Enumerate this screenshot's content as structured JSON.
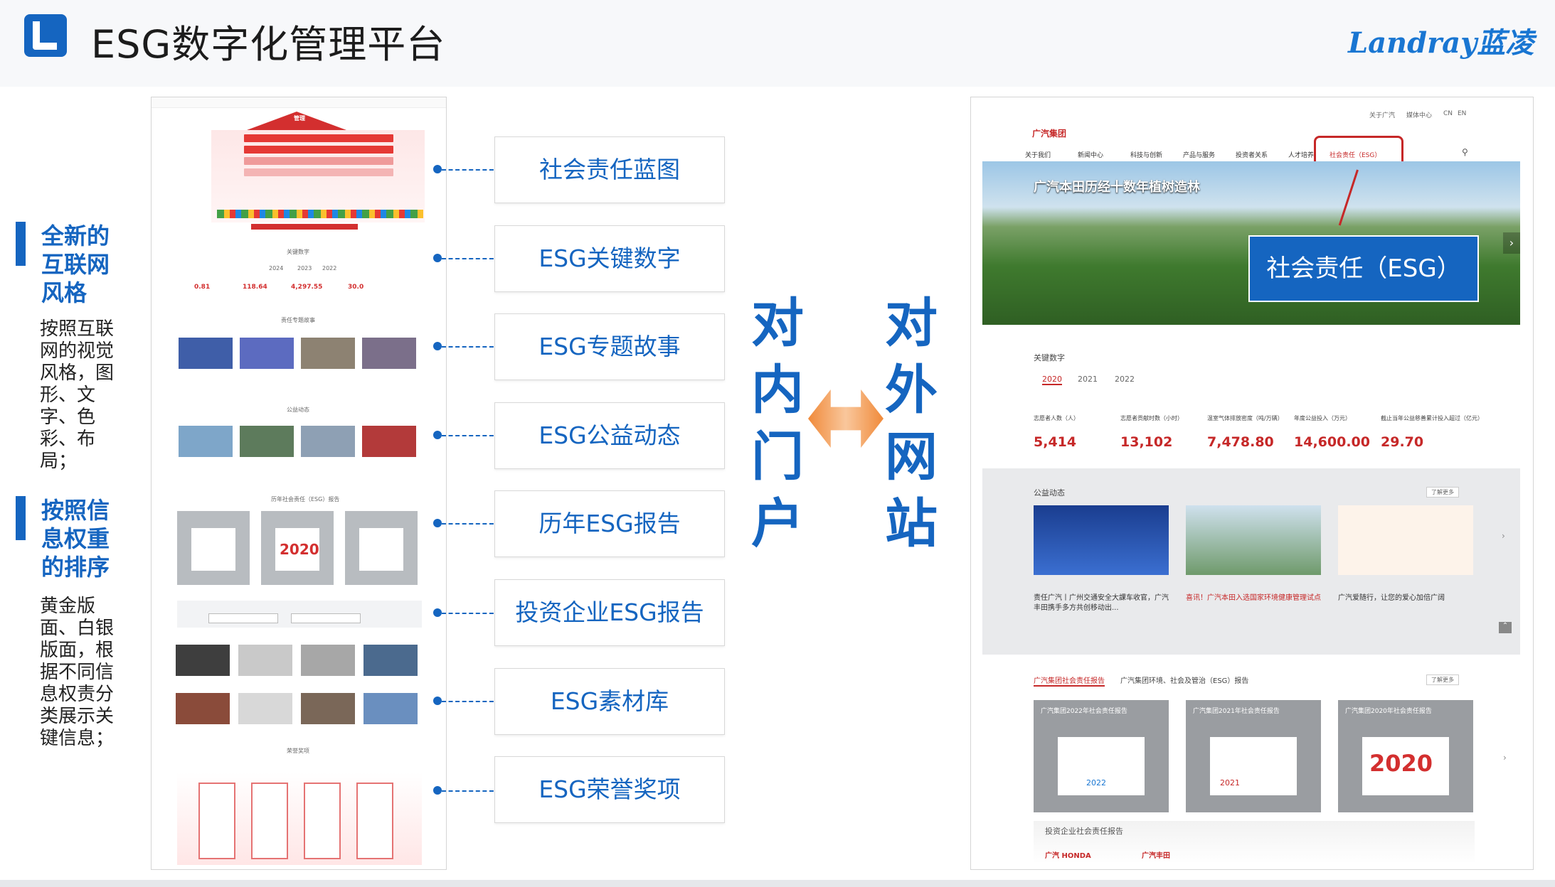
{
  "header": {
    "title": "ESG数字化管理平台",
    "brand": "Landray蓝凌"
  },
  "left_panel": {
    "sections": [
      {
        "heading": "全新的互联网风格",
        "body": "按照互联网的视觉风格，图形、文字、色彩、布局；"
      },
      {
        "heading": "按照信息权重的排序",
        "body": "黄金版面、白银版面，根据不同信息权责分类展示关键信息；"
      }
    ]
  },
  "features": [
    {
      "label": "社会责任蓝图"
    },
    {
      "label": "ESG关键数字"
    },
    {
      "label": "ESG专题故事"
    },
    {
      "label": "ESG公益动态"
    },
    {
      "label": "历年ESG报告"
    },
    {
      "label": "投资企业ESG报告"
    },
    {
      "label": "ESG素材库"
    },
    {
      "label": "ESG荣誉奖项"
    }
  ],
  "center": {
    "left_vertical": [
      "对",
      "内",
      "门",
      "户"
    ],
    "right_vertical": [
      "对",
      "外",
      "网",
      "站"
    ]
  },
  "portal": {
    "top_label": "管理",
    "key_numbers_title": "关键数字",
    "years": [
      "2024",
      "2023",
      "2022"
    ],
    "stats": [
      {
        "value": "0.81"
      },
      {
        "value": "118.64"
      },
      {
        "value": "4,297.55"
      },
      {
        "value": "30.0"
      }
    ],
    "section_stories": "责任专题故事",
    "section_charity": "公益动态",
    "section_reports": "历年社会责任（ESG）报告",
    "report_year": "2020",
    "section_honor": "荣誉奖项"
  },
  "website": {
    "logo": "广汽集团",
    "top_links": [
      "关于广汽",
      "媒体中心",
      "CN",
      "EN"
    ],
    "nav": [
      "关于我们",
      "新闻中心",
      "科技与创新",
      "产品与服务",
      "投资者关系",
      "人才培养",
      "社会责任（ESG）"
    ],
    "hero_caption": "广汽本田历经十数年植树造林",
    "hero_button": "社会责任（ESG）",
    "key_numbers_title": "关键数字",
    "years": [
      "2020",
      "2021",
      "2022"
    ],
    "stats": [
      {
        "label": "志愿者人数（人）",
        "value": "5,414"
      },
      {
        "label": "志愿者贡献时数（小时）",
        "value": "13,102"
      },
      {
        "label": "温室气体排放密度（吨/万辆）",
        "value": "7,478.80"
      },
      {
        "label": "年度公益投入（万元）",
        "value": "14,600.00"
      },
      {
        "label": "截止当年公益慈善累计投入超过（亿元）",
        "value": "29.70"
      }
    ],
    "charity_title": "公益动态",
    "more": "了解更多",
    "news": [
      {
        "title": "责任广汽丨广州交通安全大課车收官，广汽丰田携手多方共创移动出..."
      },
      {
        "title": "喜讯！广汽本田入选国家环境健康管理试点"
      },
      {
        "title": "广汽爱随行，让您的爱心加倍广阔"
      }
    ],
    "report_tabs": [
      "广汽集团社会责任报告",
      "广汽集团环境、社会及管治（ESG）报告"
    ],
    "reports": [
      {
        "title": "广汽集团2022年社会责任报告",
        "year": "2022"
      },
      {
        "title": "广汽集团2021年社会责任报告",
        "year": "2021"
      },
      {
        "title": "广汽集团2020年社会责任报告",
        "year": "2020"
      }
    ],
    "invest_title": "投资企业社会责任报告",
    "invest_logos": [
      "广汽 HONDA",
      "广汽丰田"
    ]
  },
  "colors": {
    "accent": "#1565c0",
    "portal_red": "#d32f2f",
    "arrow": "#f08a3a"
  }
}
